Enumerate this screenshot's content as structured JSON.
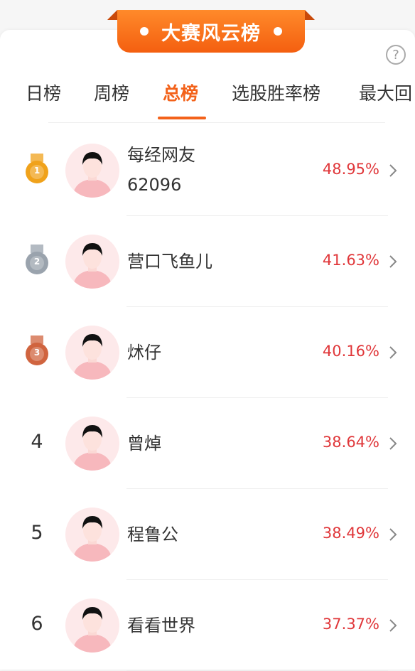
{
  "banner": {
    "title": "大赛风云榜"
  },
  "help": {
    "label": "?"
  },
  "tabs": [
    "日榜",
    "周榜",
    "总榜",
    "选股胜率榜",
    "最大回"
  ],
  "active_tab": 2,
  "rows": [
    {
      "rank": "1",
      "medal": "gold",
      "name_line1": "每经网友",
      "name_line2": "62096",
      "rate": "48.95%"
    },
    {
      "rank": "2",
      "medal": "silver",
      "name_line1": "营口飞鱼儿",
      "name_line2": "",
      "rate": "41.63%"
    },
    {
      "rank": "3",
      "medal": "bronze",
      "name_line1": "炢仔",
      "name_line2": "",
      "rate": "40.16%"
    },
    {
      "rank": "4",
      "medal": "",
      "name_line1": "曾焯",
      "name_line2": "",
      "rate": "38.64%"
    },
    {
      "rank": "5",
      "medal": "",
      "name_line1": "程鲁公",
      "name_line2": "",
      "rate": "38.49%"
    },
    {
      "rank": "6",
      "medal": "",
      "name_line1": "看看世界",
      "name_line2": "",
      "rate": "37.37%"
    }
  ],
  "colors": {
    "accent": "#f3621a",
    "rate": "#e0373a",
    "gold": "#f0a21b",
    "silver": "#9aa3ad",
    "bronze": "#d0643f",
    "avatar_bg": "#fde9ea"
  }
}
